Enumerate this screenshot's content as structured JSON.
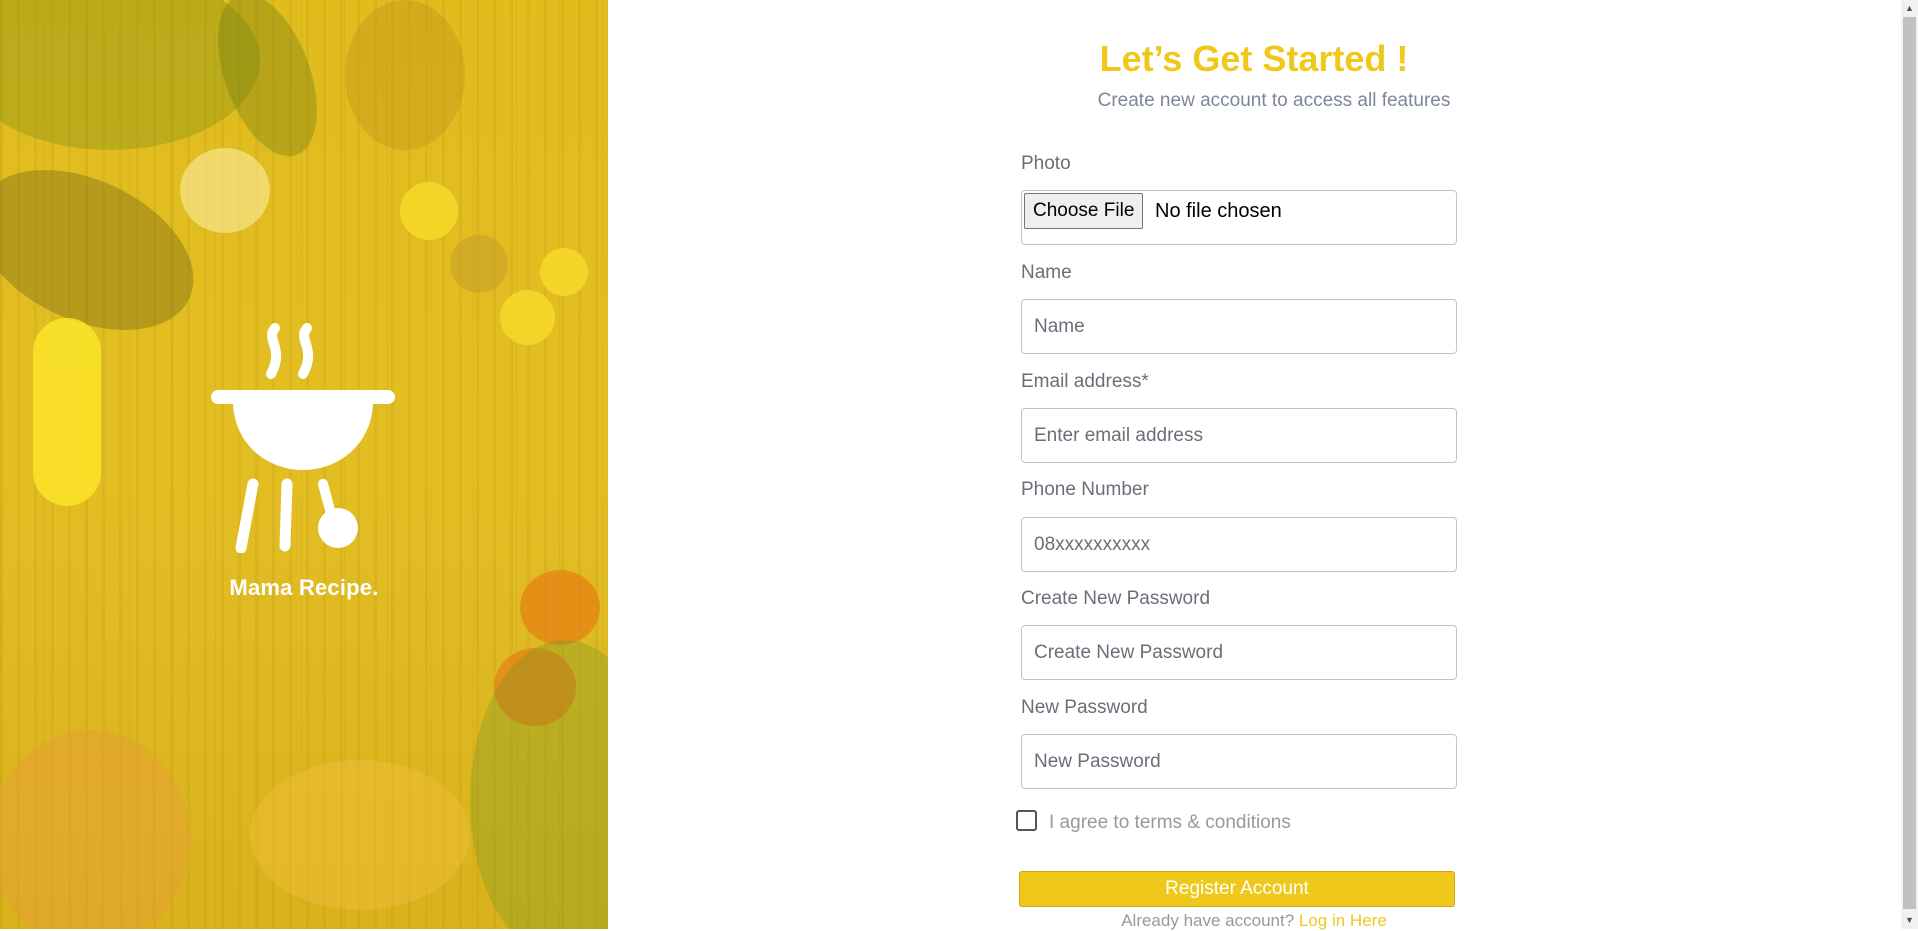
{
  "hero": {
    "brand": "Mama Recipe.",
    "logo_icon": "grill-icon"
  },
  "header": {
    "title": "Let’s Get Started !",
    "subtitle": "Create new account to access all features"
  },
  "form": {
    "photo": {
      "label": "Photo",
      "button_label": "Choose File",
      "status": "No file chosen"
    },
    "name": {
      "label": "Name",
      "placeholder": "Name",
      "value": ""
    },
    "email": {
      "label": "Email address*",
      "placeholder": "Enter email address",
      "value": ""
    },
    "phone": {
      "label": "Phone Number",
      "placeholder": "08xxxxxxxxxx",
      "value": ""
    },
    "create_password": {
      "label": "Create New Password",
      "placeholder": "Create New Password",
      "value": ""
    },
    "new_password": {
      "label": "New Password",
      "placeholder": "New Password",
      "value": ""
    },
    "terms": {
      "label": "I agree to terms & conditions",
      "checked": false
    },
    "submit_label": "Register Account",
    "login_prompt": "Already have account?",
    "login_link": "Log in Here"
  },
  "colors": {
    "accent": "#efc81a",
    "label": "#696f79",
    "muted": "#7c8799"
  }
}
